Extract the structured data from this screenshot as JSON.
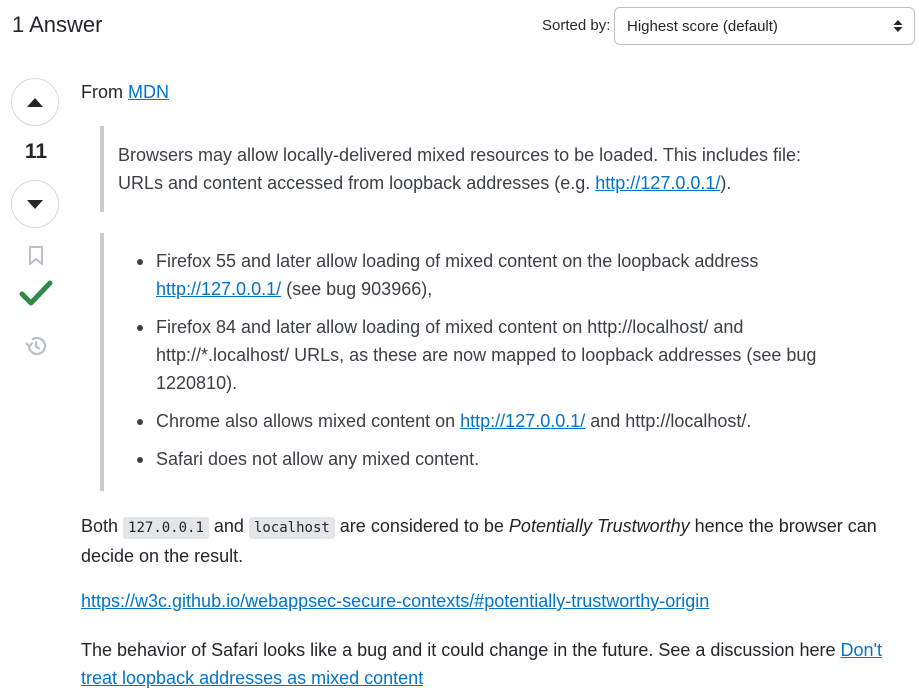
{
  "header": {
    "answers_count": "1 Answer",
    "sort_label": "Sorted by:",
    "sort_value": "Highest score (default)"
  },
  "votes": {
    "score": "11",
    "accepted_color": "#2f8a4a",
    "icons": [
      "arrow-up-icon",
      "arrow-down-icon",
      "bookmark-icon",
      "checkmark-icon",
      "history-icon"
    ]
  },
  "post": {
    "intro": {
      "text": "From ",
      "link": "MDN"
    },
    "quote1": {
      "text": "Browsers may allow locally-delivered mixed resources to be loaded. This includes file: URLs and content accessed from loopback addresses (e.g. ",
      "link": "http://127.0.0.1/",
      "suffix": ")."
    },
    "quote2": {
      "items": [
        {
          "prefix": "Firefox 55 and later allow loading of mixed content on the loopback address ",
          "link": "http://127.0.0.1/",
          "suffix": " (see bug 903966),"
        },
        {
          "text": "Firefox 84 and later allow loading of mixed content on http://localhost/ and http://*.localhost/ URLs, as these are now mapped to loopback addresses (see bug 1220810)."
        },
        {
          "prefix": "Chrome also allows mixed content on ",
          "link": "http://127.0.0.1/",
          "suffix": " and http://localhost/."
        },
        {
          "text": "Safari does not allow any mixed content."
        }
      ]
    },
    "para_both": {
      "p1": "Both ",
      "code1": "127.0.0.1",
      "p2": " and ",
      "code2": "localhost",
      "p3": " are considered to be ",
      "em": "Potentially Trustworthy",
      "p4": " hence the browser can decide on the result."
    },
    "spec_link": "https://w3c.github.io/webappsec-secure-contexts/#potentially-trustworthy-origin",
    "para_safari": {
      "text": "The behavior of Safari looks like a bug and it could change in the future. See a discussion here ",
      "link": "Don't treat loopback addresses as mixed content"
    }
  }
}
